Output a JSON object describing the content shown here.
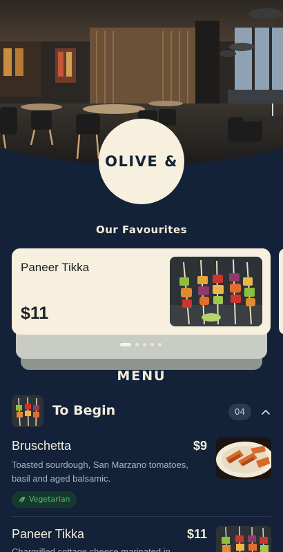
{
  "brand": {
    "name": "OLIVE &"
  },
  "favourites": {
    "title": "Our Favourites",
    "card": {
      "name": "Paneer Tikka",
      "price": "$11",
      "image": "paneer-tikka-skewers"
    },
    "pagination": {
      "total": 5,
      "active": 1
    }
  },
  "menu": {
    "title": "MENU",
    "category": {
      "name": "To Begin",
      "count": "04",
      "icon": "chevron-up-icon",
      "items": [
        {
          "name": "Bruschetta",
          "price": "$9",
          "description_line1": "Toasted sourdough, San Marzano tomatoes,",
          "description_line2": "basil and aged balsamic.",
          "badge": "Vegetarian",
          "badge_icon": "leaf-icon"
        },
        {
          "name": "Paneer Tikka",
          "price": "$11",
          "description_line1": "Chargrilled cottage cheese marinated in"
        }
      ]
    }
  },
  "colors": {
    "background": "#132238",
    "cream": "#f7f0df",
    "veg_green": "#4fbf6c"
  }
}
